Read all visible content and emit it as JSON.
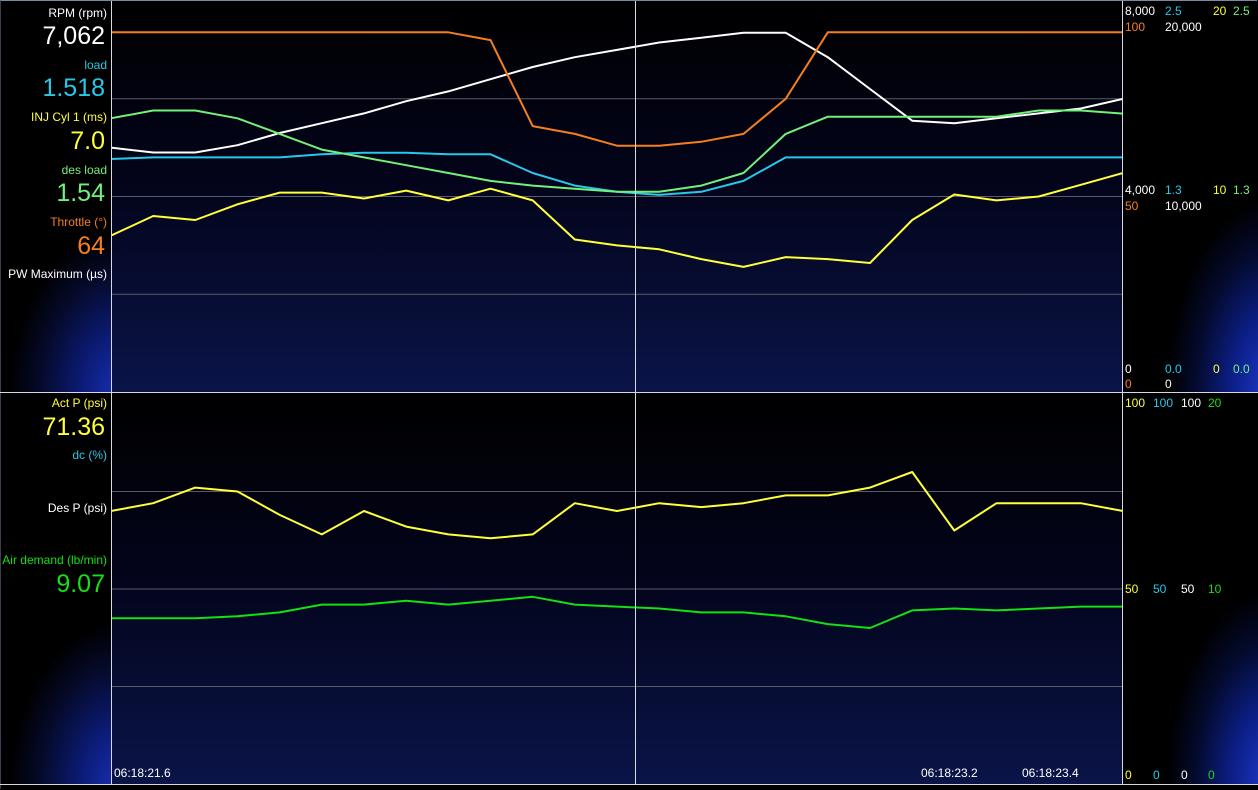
{
  "colors": {
    "rpm": "#ffffff",
    "load": "#29c8e8",
    "inj": "#ffff3a",
    "des_load": "#74f07a",
    "throttle": "#f57e20",
    "act_p": "#ffff3a",
    "dc": "#29c8e8",
    "des_p": "#ffffff",
    "demand": "#14e014"
  },
  "top_panel": {
    "channels": [
      {
        "label": "RPM (rpm)",
        "value": "7,062"
      },
      {
        "label": "load",
        "value": "1.518"
      },
      {
        "label": "INJ Cyl 1 (ms)",
        "value": "7.0"
      },
      {
        "label": "des load",
        "value": "1.54"
      },
      {
        "label": "Throttle (°)",
        "value": "64"
      },
      {
        "label": "PW Maximum (µs)",
        "value": ""
      }
    ],
    "axis_top": [
      "8,000",
      "2.5",
      "20",
      "2.5",
      "100",
      "20,000"
    ],
    "axis_mid": [
      "4,000",
      "1.3",
      "10",
      "1.3",
      "50",
      "10,000"
    ],
    "axis_bot": [
      "0",
      "0.0",
      "0",
      "0.0",
      "0",
      "0"
    ]
  },
  "bottom_panel": {
    "channels": [
      {
        "label": "Act P (psi)",
        "value": "71.36"
      },
      {
        "label": "dc (%)",
        "value": ""
      },
      {
        "label": "Des P (psi)",
        "value": ""
      },
      {
        "label": "Air demand (lb/min)",
        "value": "9.07"
      }
    ],
    "axis_top": [
      "100",
      "100",
      "100",
      "20"
    ],
    "axis_mid": [
      "50",
      "50",
      "50",
      "10"
    ],
    "axis_bot": [
      "0",
      "0",
      "0",
      "0"
    ]
  },
  "timestamps": [
    "06:18:21.6",
    "06:18:23.2",
    "06:18:23.4"
  ],
  "chart_data": [
    {
      "type": "line",
      "x_samples": 25,
      "series": [
        {
          "name": "RPM (rpm)",
          "ylim": [
            0,
            8000
          ],
          "values": [
            5000,
            4900,
            4900,
            5050,
            5300,
            5500,
            5700,
            5950,
            6150,
            6400,
            6650,
            6850,
            7000,
            7150,
            7250,
            7350,
            7350,
            6850,
            6200,
            5550,
            5500,
            5600,
            5700,
            5800,
            6000
          ]
        },
        {
          "name": "load",
          "ylim": [
            0,
            2.5
          ],
          "values": [
            1.49,
            1.5,
            1.5,
            1.5,
            1.5,
            1.52,
            1.53,
            1.53,
            1.52,
            1.52,
            1.4,
            1.32,
            1.28,
            1.26,
            1.28,
            1.35,
            1.5,
            1.5,
            1.5,
            1.5,
            1.5,
            1.5,
            1.5,
            1.5,
            1.5
          ]
        },
        {
          "name": "INJ Cyl 1 (ms)",
          "ylim": [
            0,
            20
          ],
          "values": [
            8.0,
            9.0,
            8.8,
            9.6,
            10.2,
            10.2,
            9.9,
            10.3,
            9.8,
            10.4,
            9.8,
            7.8,
            7.5,
            7.3,
            6.8,
            6.4,
            6.9,
            6.8,
            6.6,
            8.8,
            10.1,
            9.8,
            10.0,
            10.6,
            11.2
          ]
        },
        {
          "name": "des load",
          "ylim": [
            0,
            2.5
          ],
          "values": [
            1.75,
            1.8,
            1.8,
            1.75,
            1.65,
            1.55,
            1.5,
            1.45,
            1.4,
            1.35,
            1.32,
            1.3,
            1.28,
            1.28,
            1.32,
            1.4,
            1.65,
            1.76,
            1.76,
            1.76,
            1.76,
            1.76,
            1.8,
            1.8,
            1.78
          ]
        },
        {
          "name": "Throttle (°)",
          "ylim": [
            0,
            100
          ],
          "values": [
            92,
            92,
            92,
            92,
            92,
            92,
            92,
            92,
            92,
            90,
            68,
            66,
            63,
            63,
            64,
            66,
            75,
            92,
            92,
            92,
            92,
            92,
            92,
            92,
            92
          ]
        }
      ]
    },
    {
      "type": "line",
      "x_samples": 25,
      "series": [
        {
          "name": "Act P (psi)",
          "ylim": [
            0,
            100
          ],
          "values": [
            70,
            72,
            76,
            75,
            69,
            64,
            70,
            66,
            64,
            63,
            64,
            72,
            70,
            72,
            71,
            72,
            74,
            74,
            76,
            80,
            65,
            72,
            72,
            72,
            70
          ]
        },
        {
          "name": "Air demand (lb/min)",
          "ylim": [
            0,
            20
          ],
          "values": [
            8.5,
            8.5,
            8.5,
            8.6,
            8.8,
            9.2,
            9.2,
            9.4,
            9.2,
            9.4,
            9.6,
            9.2,
            9.1,
            9.0,
            8.8,
            8.8,
            8.6,
            8.2,
            8.0,
            8.9,
            9.0,
            8.9,
            9.0,
            9.1,
            9.1
          ]
        }
      ]
    }
  ]
}
